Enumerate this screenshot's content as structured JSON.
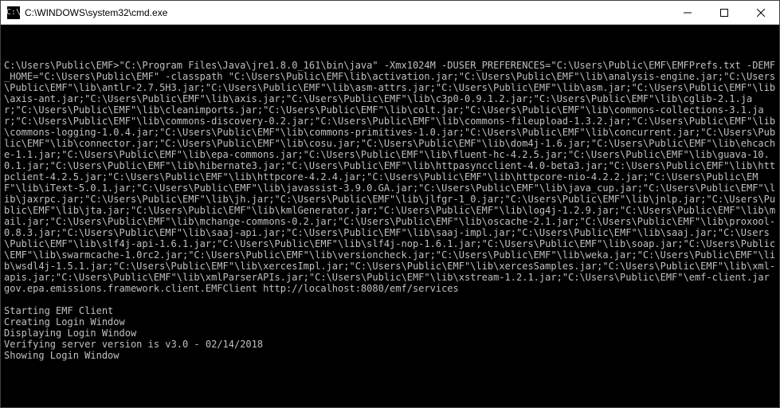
{
  "window": {
    "title": "C:\\WINDOWS\\system32\\cmd.exe"
  },
  "terminal": {
    "command_block": "C:\\Users\\Public\\EMF>\"C:\\Program Files\\Java\\jre1.8.0_161\\bin\\java\" -Xmx1024M -DUSER_PREFERENCES=\"C:\\Users\\Public\\EMF\\EMFPrefs.txt -DEMF_HOME=\"C:\\Users\\Public\\EMF\" -classpath \"C:\\Users\\Public\\EMF\\lib\\activation.jar;\"C:\\Users\\Public\\EMF\"\\lib\\analysis-engine.jar;\"C:\\Users\\Public\\EMF\"\\lib\\antlr-2.7.5H3.jar;\"C:\\Users\\Public\\EMF\"\\lib\\asm-attrs.jar;\"C:\\Users\\Public\\EMF\"\\lib\\asm.jar;\"C:\\Users\\Public\\EMF\"\\lib\\axis-ant.jar;\"C:\\Users\\Public\\EMF\"\\lib\\axis.jar;\"C:\\Users\\Public\\EMF\"\\lib\\c3p0-0.9.1.2.jar;\"C:\\Users\\Public\\EMF\"\\lib\\cglib-2.1.jar;\"C:\\Users\\Public\\EMF\"\\lib\\cleanimports.jar;\"C:\\Users\\Public\\EMF\"\\lib\\colt.jar;\"C:\\Users\\Public\\EMF\"\\lib\\commons-collections-3.1.jar;\"C:\\Users\\Public\\EMF\"\\lib\\commons-discovery-0.2.jar;\"C:\\Users\\Public\\EMF\"\\lib\\commons-fileupload-1.3.2.jar;\"C:\\Users\\Public\\EMF\"\\lib\\commons-logging-1.0.4.jar;\"C:\\Users\\Public\\EMF\"\\lib\\commons-primitives-1.0.jar;\"C:\\Users\\Public\\EMF\"\\lib\\concurrent.jar;\"C:\\Users\\Public\\EMF\"\\lib\\connector.jar;\"C:\\Users\\Public\\EMF\"\\lib\\cosu.jar;\"C:\\Users\\Public\\EMF\"\\lib\\dom4j-1.6.jar;\"C:\\Users\\Public\\EMF\"\\lib\\ehcache-1.1.jar;\"C:\\Users\\Public\\EMF\"\\lib\\epa-commons.jar;\"C:\\Users\\Public\\EMF\"\\lib\\fluent-hc-4.2.5.jar;\"C:\\Users\\Public\\EMF\"\\lib\\guava-10.0.1.jar;\"C:\\Users\\Public\\EMF\"\\lib\\hibernate3.jar;\"C:\\Users\\Public\\EMF\"\\lib\\httpasyncclient-4.0-beta3.jar;\"C:\\Users\\Public\\EMF\"\\lib\\httpclient-4.2.5.jar;\"C:\\Users\\Public\\EMF\"\\lib\\httpcore-4.2.4.jar;\"C:\\Users\\Public\\EMF\"\\lib\\httpcore-nio-4.2.2.jar;\"C:\\Users\\Public\\EMF\"\\lib\\iText-5.0.1.jar;\"C:\\Users\\Public\\EMF\"\\lib\\javassist-3.9.0.GA.jar;\"C:\\Users\\Public\\EMF\"\\lib\\java_cup.jar;\"C:\\Users\\Public\\EMF\"\\lib\\jaxrpc.jar;\"C:\\Users\\Public\\EMF\"\\lib\\jh.jar;\"C:\\Users\\Public\\EMF\"\\lib\\jlfgr-1_0.jar;\"C:\\Users\\Public\\EMF\"\\lib\\jnlp.jar;\"C:\\Users\\Public\\EMF\"\\lib\\jta.jar;\"C:\\Users\\Public\\EMF\"\\lib\\kmlGenerator.jar;\"C:\\Users\\Public\\EMF\"\\lib\\log4j-1.2.9.jar;\"C:\\Users\\Public\\EMF\"\\lib\\mail.jar;\"C:\\Users\\Public\\EMF\"\\lib\\mchange-commons-0.2.jar;\"C:\\Users\\Public\\EMF\"\\lib\\oscache-2.1.jar;\"C:\\Users\\Public\\EMF\"\\lib\\proxool-0.8.3.jar;\"C:\\Users\\Public\\EMF\"\\lib\\saaj-api.jar;\"C:\\Users\\Public\\EMF\"\\lib\\saaj-impl.jar;\"C:\\Users\\Public\\EMF\"\\lib\\saaj.jar;\"C:\\Users\\Public\\EMF\"\\lib\\slf4j-api-1.6.1.jar;\"C:\\Users\\Public\\EMF\"\\lib\\slf4j-nop-1.6.1.jar;\"C:\\Users\\Public\\EMF\"\\lib\\soap.jar;\"C:\\Users\\Public\\EMF\"\\lib\\swarmcache-1.0rc2.jar;\"C:\\Users\\Public\\EMF\"\\lib\\versioncheck.jar;\"C:\\Users\\Public\\EMF\"\\lib\\weka.jar;\"C:\\Users\\Public\\EMF\"\\lib\\wsdl4j-1.5.1.jar;\"C:\\Users\\Public\\EMF\"\\lib\\xercesImpl.jar;\"C:\\Users\\Public\\EMF\"\\lib\\xercesSamples.jar;\"C:\\Users\\Public\\EMF\"\\lib\\xml-apis.jar;\"C:\\Users\\Public\\EMF\"\\lib\\xmlParserAPIs.jar;\"C:\\Users\\Public\\EMF\"\\lib\\xstream-1.2.1.jar;\"C:\\Users\\Public\\EMF\"\\emf-client.jar gov.epa.emissions.framework.client.EMFClient http://localhost:8080/emf/services",
    "status_lines": [
      "Starting EMF Client",
      "Creating Login Window",
      "Displaying Login Window",
      "Verifying server version is v3.0 - 02/14/2018",
      "Showing Login Window"
    ]
  }
}
